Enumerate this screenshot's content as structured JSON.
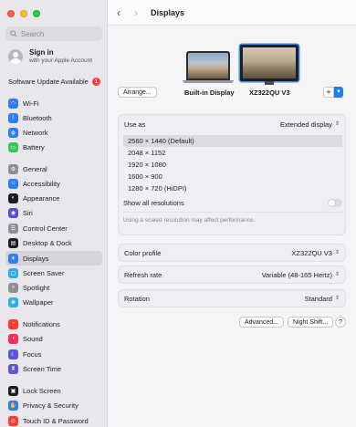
{
  "sidebar": {
    "search_placeholder": "Search",
    "account": {
      "title": "Sign in",
      "subtitle": "with your Apple Account"
    },
    "update": {
      "label": "Software Update Available",
      "badge": "1"
    },
    "items": [
      {
        "label": "Wi-Fi",
        "icon": "wifi-icon",
        "color": "#2f7cf6"
      },
      {
        "label": "Bluetooth",
        "icon": "bluetooth-icon",
        "color": "#2f7cf6"
      },
      {
        "label": "Network",
        "icon": "globe-icon",
        "color": "#2f7cf6"
      },
      {
        "label": "Battery",
        "icon": "battery-icon",
        "color": "#34c759"
      },
      {
        "label": "General",
        "icon": "gear-icon",
        "color": "#8e8e93"
      },
      {
        "label": "Accessibility",
        "icon": "accessibility-icon",
        "color": "#2f7cf6"
      },
      {
        "label": "Appearance",
        "icon": "appearance-icon",
        "color": "#1c1c1e"
      },
      {
        "label": "Siri",
        "icon": "siri-icon",
        "color": "#5a4fcf"
      },
      {
        "label": "Control Center",
        "icon": "control-center-icon",
        "color": "#8e8e93"
      },
      {
        "label": "Desktop & Dock",
        "icon": "dock-icon",
        "color": "#1c1c1e"
      },
      {
        "label": "Displays",
        "icon": "sun-icon",
        "color": "#2f7cf6"
      },
      {
        "label": "Screen Saver",
        "icon": "screen-saver-icon",
        "color": "#32ade6"
      },
      {
        "label": "Spotlight",
        "icon": "magnifier-icon",
        "color": "#8e8e93"
      },
      {
        "label": "Wallpaper",
        "icon": "wallpaper-icon",
        "color": "#32ade6"
      },
      {
        "label": "Notifications",
        "icon": "bell-icon",
        "color": "#ff3b30"
      },
      {
        "label": "Sound",
        "icon": "speaker-icon",
        "color": "#ff2d55"
      },
      {
        "label": "Focus",
        "icon": "moon-icon",
        "color": "#5856d6"
      },
      {
        "label": "Screen Time",
        "icon": "hourglass-icon",
        "color": "#5856d6"
      },
      {
        "label": "Lock Screen",
        "icon": "lock-icon",
        "color": "#1c1c1e"
      },
      {
        "label": "Privacy & Security",
        "icon": "hand-icon",
        "color": "#2f7cf6"
      },
      {
        "label": "Touch ID & Password",
        "icon": "fingerprint-icon",
        "color": "#ff3b30"
      }
    ]
  },
  "main": {
    "title": "Displays",
    "arrange_label": "Arrange...",
    "builtin_label": "Built-in Display",
    "external_label": "XZ322QU V3",
    "plus_label": "+",
    "use_as": {
      "label": "Use as",
      "value": "Extended display"
    },
    "resolutions": [
      "2560 × 1440 (Default)",
      "2048 × 1152",
      "1920 × 1080",
      "1600 × 900",
      "1280 × 720 (HiDPI)"
    ],
    "show_all_label": "Show all resolutions",
    "scaled_note": "Using a scaled resolution may affect performance.",
    "color_profile": {
      "label": "Color profile",
      "value": "XZ322QU V3"
    },
    "refresh_rate": {
      "label": "Refresh rate",
      "value": "Variable (48-165 Hertz)"
    },
    "rotation": {
      "label": "Rotation",
      "value": "Standard"
    },
    "advanced_label": "Advanced...",
    "night_shift_label": "Night Shift...",
    "help_label": "?"
  }
}
